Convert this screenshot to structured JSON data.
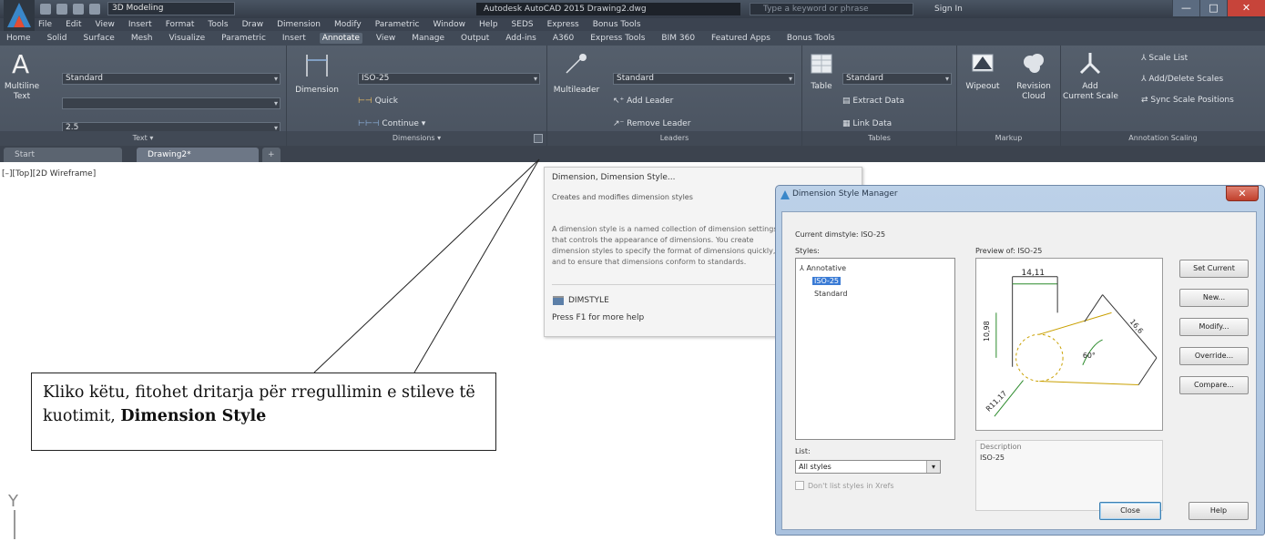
{
  "title_bar": {
    "workspace": "3D Modeling",
    "title": "Autodesk AutoCAD 2015   Drawing2.dwg",
    "search_placeholder": "Type a keyword or phrase",
    "signin": "Sign In",
    "win_controls": [
      "—",
      "□",
      "✕"
    ]
  },
  "menu_bar": [
    "File",
    "Edit",
    "View",
    "Insert",
    "Format",
    "Tools",
    "Draw",
    "Dimension",
    "Modify",
    "Parametric",
    "Window",
    "Help",
    "SEDS",
    "Express",
    "Bonus Tools"
  ],
  "ribbon_tabs": [
    "Home",
    "Solid",
    "Surface",
    "Mesh",
    "Visualize",
    "Parametric",
    "Insert",
    "Annotate",
    "View",
    "Manage",
    "Output",
    "Add-ins",
    "A360",
    "Express Tools",
    "BIM 360",
    "Featured Apps",
    "Bonus Tools"
  ],
  "active_ribbon_tab": "Annotate",
  "ribbon": {
    "text_panel": {
      "title": "Text ▾",
      "big_button": "Multiline\nText",
      "style_combo": "Standard",
      "find_combo": "",
      "height_combo": "2.5"
    },
    "dimensions_panel": {
      "title": "Dimensions ▾",
      "big_button": "Dimension",
      "style_combo": "ISO-25",
      "quick": "Quick",
      "continue": "Continue ▾"
    },
    "leaders_panel": {
      "title": "Leaders",
      "big_button": "Multileader",
      "style_combo": "Standard",
      "add_leader": "Add Leader",
      "remove_leader": "Remove Leader"
    },
    "tables_panel": {
      "title": "Tables",
      "big_button": "Table",
      "style_combo": "Standard",
      "extract": "Extract Data",
      "link": "Link Data"
    },
    "markup_panel": {
      "title": "Markup",
      "wipeout": "Wipeout",
      "revcloud": "Revision\nCloud"
    },
    "scaling_panel": {
      "title": "Annotation Scaling",
      "add_scale": "Add\nCurrent Scale",
      "scale_list": "Scale List",
      "add_delete": "Add/Delete Scales",
      "sync": "Sync Scale Positions"
    }
  },
  "doc_tabs": [
    "Start",
    "Drawing2*",
    "+"
  ],
  "viewport_label": "[–][Top][2D Wireframe]",
  "tooltip": {
    "title": "Dimension, Dimension Style...",
    "subtitle": "Creates and modifies dimension styles",
    "description": "A dimension style is a named collection of dimension settings that controls the appearance of dimensions. You create dimension styles to specify the format of dimensions quickly, and to ensure that dimensions conform to standards.",
    "command": "DIMSTYLE",
    "help": "Press F1 for more help"
  },
  "dialog": {
    "title": "Dimension Style Manager",
    "current_style": "Current dimstyle: ISO-25",
    "styles_label": "Styles:",
    "styles": [
      "Annotative",
      "ISO-25",
      "Standard"
    ],
    "selected_style": "ISO-25",
    "preview_label": "Preview of: ISO-25",
    "preview_dims": [
      "14,11",
      "16,6",
      "10,98",
      "60°",
      "R11,17"
    ],
    "list_label": "List:",
    "list_value": "All styles",
    "xref_checkbox": "Don't list styles in Xrefs",
    "description_label": "Description",
    "description_value": "ISO-25",
    "buttons": [
      "Set Current",
      "New...",
      "Modify...",
      "Override...",
      "Compare..."
    ],
    "close": "Close",
    "help": "Help"
  },
  "callout": {
    "text": "Kliko këtu, fitohet dritarja për rregullimin e stileve të kuotimit, ",
    "bold": "Dimension Style"
  },
  "ucs_label": "Y"
}
